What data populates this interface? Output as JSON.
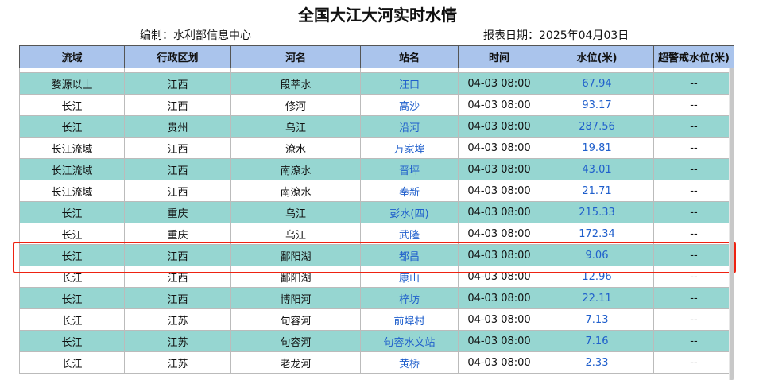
{
  "page": {
    "title": "全国大江大河实时水情",
    "compiler": "编制：水利部信息中心",
    "report_date": "报表日期：2025年04月03日"
  },
  "table": {
    "headers": [
      "流域",
      "行政区划",
      "河名",
      "站名",
      "时间",
      "水位(米)",
      "超警戒水位(米)"
    ],
    "rows": [
      {
        "basin": "婺源以上",
        "region": "江西",
        "river": "段莘水",
        "station": "汪口",
        "time": "04-03 08:00",
        "level": "67.94",
        "over": "--"
      },
      {
        "basin": "长江",
        "region": "江西",
        "river": "修河",
        "station": "高沙",
        "time": "04-03 08:00",
        "level": "93.17",
        "over": "--"
      },
      {
        "basin": "长江",
        "region": "贵州",
        "river": "乌江",
        "station": "沿河",
        "time": "04-03 08:00",
        "level": "287.56",
        "over": "--"
      },
      {
        "basin": "长江流域",
        "region": "江西",
        "river": "潦水",
        "station": "万家埠",
        "time": "04-03 08:00",
        "level": "19.81",
        "over": "--"
      },
      {
        "basin": "长江流域",
        "region": "江西",
        "river": "南潦水",
        "station": "晋坪",
        "time": "04-03 08:00",
        "level": "43.01",
        "over": "--"
      },
      {
        "basin": "长江流域",
        "region": "江西",
        "river": "南潦水",
        "station": "奉新",
        "time": "04-03 08:00",
        "level": "21.71",
        "over": "--"
      },
      {
        "basin": "长江",
        "region": "重庆",
        "river": "乌江",
        "station": "彭水(四)",
        "time": "04-03 08:00",
        "level": "215.33",
        "over": "--"
      },
      {
        "basin": "长江",
        "region": "重庆",
        "river": "乌江",
        "station": "武隆",
        "time": "04-03 08:00",
        "level": "172.34",
        "over": "--"
      },
      {
        "basin": "长江",
        "region": "江西",
        "river": "鄱阳湖",
        "station": "都昌",
        "time": "04-03 08:00",
        "level": "9.06",
        "over": "--"
      },
      {
        "basin": "长江",
        "region": "江西",
        "river": "鄱阳湖",
        "station": "康山",
        "time": "04-03 08:00",
        "level": "12.96",
        "over": "--"
      },
      {
        "basin": "长江",
        "region": "江西",
        "river": "博阳河",
        "station": "梓坊",
        "time": "04-03 08:00",
        "level": "22.11",
        "over": "--"
      },
      {
        "basin": "长江",
        "region": "江苏",
        "river": "句容河",
        "station": "前埠村",
        "time": "04-03 08:00",
        "level": "7.13",
        "over": "--"
      },
      {
        "basin": "长江",
        "region": "江苏",
        "river": "句容河",
        "station": "句容水文站",
        "time": "04-03 08:00",
        "level": "7.16",
        "over": "--"
      },
      {
        "basin": "长江",
        "region": "江苏",
        "river": "老龙河",
        "station": "黄桥",
        "time": "04-03 08:00",
        "level": "2.33",
        "over": "--"
      }
    ]
  },
  "colors": {
    "header_bg": "#aac4ec",
    "alt_row_bg": "#96d6d1",
    "link_text": "#1f5fcc",
    "highlight_border": "#ee2211"
  }
}
